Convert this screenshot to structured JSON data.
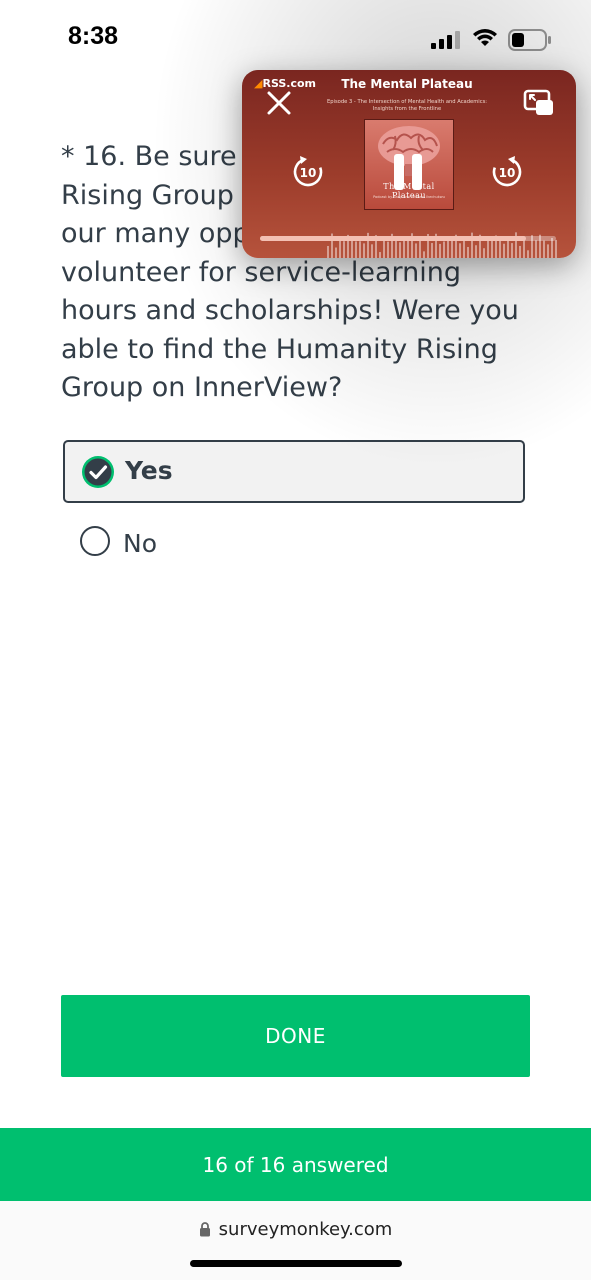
{
  "status_bar": {
    "time": "8:38"
  },
  "question": {
    "text": "* 16. Be sure to join the Humanity Rising Group on InnerView to see our many opportunities to volunteer for service-learning hours and scholarships! Were you able to find the Humanity Rising Group on InnerView?"
  },
  "answers": [
    {
      "label": "Yes",
      "selected": true
    },
    {
      "label": "No",
      "selected": false
    }
  ],
  "done_button": {
    "label": "DONE"
  },
  "progress": {
    "text": "16 of 16 answered",
    "answered": 16,
    "total": 16
  },
  "browser": {
    "url": "surveymonkey.com"
  },
  "pip_player": {
    "brand": "RSS.com",
    "show_title": "The Mental Plateau",
    "episode_title": "Episode 3 - The Intersection of Mental Health and Academics: Insights from the Frontline",
    "artwork_title": "The Mental Plateau",
    "artwork_subtitle": "Podcast by Banji and Princess Ikechukwu",
    "skip_back_seconds": "10",
    "skip_forward_seconds": "10",
    "progress_fraction": 0.9
  },
  "colors": {
    "brand_green": "#00bf6f",
    "text_dark": "#333e48",
    "pip_bg": "#9c3c2b"
  },
  "icons": [
    "signal-icon",
    "wifi-icon",
    "battery-icon",
    "checkmark-icon",
    "radio-icon",
    "lock-icon",
    "close-icon",
    "pip-expand-icon",
    "skip-back-10-icon",
    "pause-icon",
    "skip-forward-10-icon",
    "brain-artwork-icon"
  ]
}
